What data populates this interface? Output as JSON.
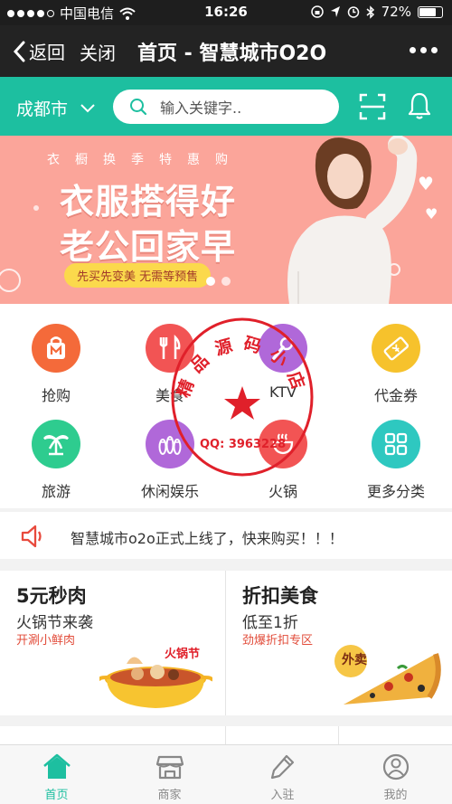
{
  "status": {
    "carrier": "中国电信",
    "time": "16:26",
    "battery": "72%"
  },
  "nav": {
    "back": "返回",
    "close": "关闭",
    "title": "首页 - 智慧城市O2O"
  },
  "header": {
    "city": "成都市",
    "search_placeholder": "输入关键字.."
  },
  "banner": {
    "subtitle": "衣橱换季特惠购",
    "line1": "衣服搭得好",
    "line2": "老公回家早",
    "tag": "先买先变美  无需等预售"
  },
  "categories": [
    {
      "label": "抢购",
      "color": "#f46a3a",
      "icon": "shopping-bag-icon"
    },
    {
      "label": "美食",
      "color": "#f25454",
      "icon": "fork-knife-icon"
    },
    {
      "label": "KTV",
      "color": "#b068d9",
      "icon": "microphone-icon"
    },
    {
      "label": "代金券",
      "color": "#f6c22c",
      "icon": "voucher-icon"
    },
    {
      "label": "旅游",
      "color": "#2ecc8f",
      "icon": "palm-tree-icon"
    },
    {
      "label": "休闲娱乐",
      "color": "#b068d9",
      "icon": "bowling-icon"
    },
    {
      "label": "火锅",
      "color": "#f25454",
      "icon": "hotpot-icon"
    },
    {
      "label": "更多分类",
      "color": "#2ec8c0",
      "icon": "grid-icon"
    }
  ],
  "notice": "智慧城市o2o正式上线了，快来购买！！！",
  "promos": [
    {
      "title": "5元秒肉",
      "subtitle": "火锅节来袭",
      "tag": "开涮小鲜肉"
    },
    {
      "title": "折扣美食",
      "subtitle": "低至1折",
      "tag": "劲爆折扣专区",
      "badge": "外卖"
    }
  ],
  "stamp": {
    "text": "精品源码小店",
    "qq": "QQ: 3963228"
  },
  "tabs": [
    {
      "label": "首页",
      "icon": "home-icon",
      "active": true
    },
    {
      "label": "商家",
      "icon": "store-icon"
    },
    {
      "label": "入驻",
      "icon": "pencil-icon"
    },
    {
      "label": "我的",
      "icon": "user-icon"
    }
  ],
  "colors": {
    "accent": "#1dbfa0",
    "banner": "#fba59a",
    "stamp": "#e0202a"
  }
}
